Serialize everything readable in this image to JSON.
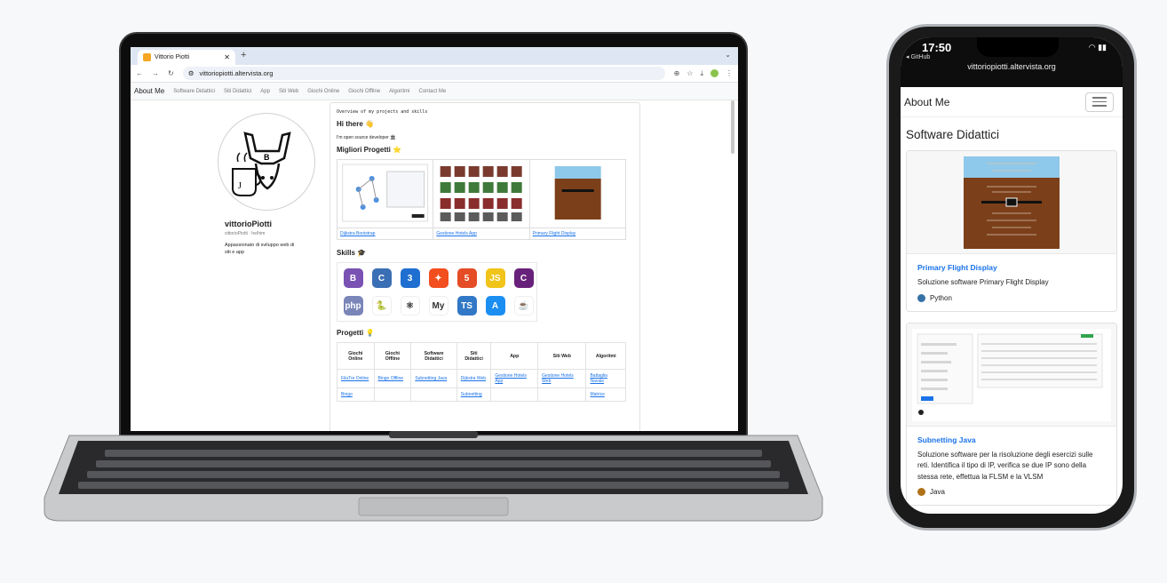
{
  "laptop": {
    "tab_title": "Vittorio Piotti",
    "new_tab": "+",
    "url": "vittoriopiotti.altervista.org",
    "nav": {
      "brand": "About Me",
      "items": [
        "Software Didattici",
        "Siti Didattici",
        "App",
        "Siti Web",
        "Giochi Online",
        "Giochi Offline",
        "Algoritmi",
        "Contact Me"
      ]
    },
    "profile": {
      "name": "vittorioPiotti",
      "username": "vittorioPiotti · he/him",
      "bio": "Appassionato di sviluppo web di siti e app"
    },
    "readme": {
      "overview": "Overview of my projects and skills",
      "hi": "Hi there 👋",
      "intro": "I'm open source developer 🏛",
      "best_title": "Migliori Progetti ⭐",
      "best_projects": [
        "Dijkstra Bootstrap",
        "Gestione Hotels App",
        "Primary Flight Display"
      ],
      "skills_title": "Skills 🎓",
      "projects_title": "Progetti 💡",
      "categories": [
        "Giochi Online",
        "Giochi Offline",
        "Software Didattici",
        "Siti Didattici",
        "App",
        "Siti Web",
        "Algoritmi"
      ],
      "row1": [
        "FilaTre Online",
        "Bingo Offline",
        "Subnetting Java",
        "Dijkstra Web",
        "Gestione Hotels App",
        "Gestione Hotels Web",
        "Battaglia Navale"
      ],
      "row2": [
        "Bingo",
        "",
        "",
        "Subnetting",
        "",
        "",
        "Matrice"
      ]
    },
    "skills": [
      {
        "icon": "bootstrap-icon",
        "glyph": "B",
        "color": "#7952b3"
      },
      {
        "icon": "c-icon",
        "glyph": "C",
        "color": "#3b6fb5"
      },
      {
        "icon": "css3-icon",
        "glyph": "3",
        "color": "#1f6fd1"
      },
      {
        "icon": "figma-icon",
        "glyph": "✦",
        "color": "#f24e1e"
      },
      {
        "icon": "html5-icon",
        "glyph": "5",
        "color": "#e44d26"
      },
      {
        "icon": "javascript-icon",
        "glyph": "JS",
        "color": "#f0c419"
      },
      {
        "icon": "csharp-icon",
        "glyph": "C",
        "color": "#68217a"
      },
      {
        "icon": "php-icon",
        "glyph": "php",
        "color": "#7a86b8"
      },
      {
        "icon": "python-icon",
        "glyph": "🐍",
        "color": "#ffffff"
      },
      {
        "icon": "react-icon",
        "glyph": "⚛",
        "color": "#ffffff"
      },
      {
        "icon": "mysql-icon",
        "glyph": "My",
        "color": "#ffffff"
      },
      {
        "icon": "typescript-icon",
        "glyph": "TS",
        "color": "#3178c6"
      },
      {
        "icon": "appstore-icon",
        "glyph": "A",
        "color": "#1b8ef2"
      },
      {
        "icon": "java-icon",
        "glyph": "☕",
        "color": "#ffffff"
      }
    ]
  },
  "phone": {
    "time": "17:50",
    "back_label": "◂ GitHub",
    "url": "vittoriopiotti.altervista.org",
    "brand": "About Me",
    "section_title": "Software Didattici",
    "cards": [
      {
        "title": "Primary Flight Display",
        "text": "Soluzione software Primary Flight Display",
        "lang": "Python",
        "lang_color": "#3572a5"
      },
      {
        "title": "Subnetting Java",
        "text": "Soluzione software per la risoluzione degli esercizi sulle reti. Identifica il tipo di IP, verifica se due IP sono della stessa rete, effettua la FLSM e la VLSM",
        "lang": "Java",
        "lang_color": "#b07219"
      }
    ]
  }
}
